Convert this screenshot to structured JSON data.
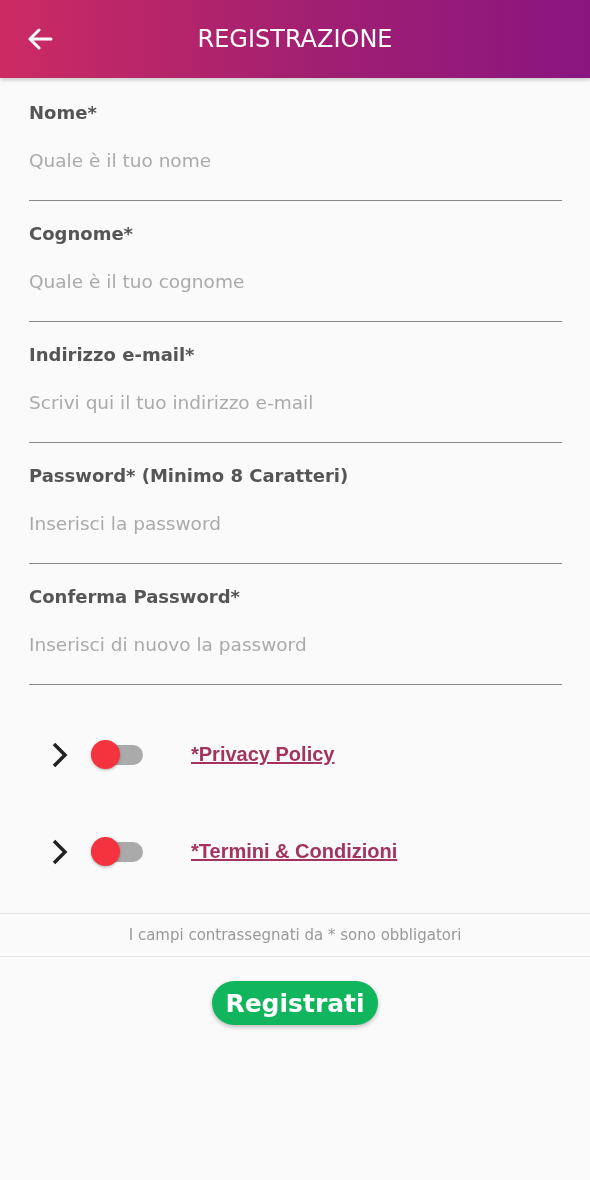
{
  "header": {
    "title": "REGISTRAZIONE"
  },
  "fields": [
    {
      "label": "Nome*",
      "placeholder": "Quale è il tuo nome"
    },
    {
      "label": "Cognome*",
      "placeholder": "Quale è il tuo cognome"
    },
    {
      "label": "Indirizzo e-mail*",
      "placeholder": "Scrivi qui il tuo indirizzo e-mail"
    },
    {
      "label": "Password* (Minimo 8 Caratteri)",
      "placeholder": "Inserisci la password"
    },
    {
      "label": "Conferma Password*",
      "placeholder": "Inserisci di nuovo la password"
    }
  ],
  "consents": [
    {
      "link": "*Privacy Policy",
      "on": false
    },
    {
      "link": "*Termini & Condizioni",
      "on": false
    }
  ],
  "note": "I campi contrassegnati da * sono obbligatori",
  "submit_button": "Registrati"
}
